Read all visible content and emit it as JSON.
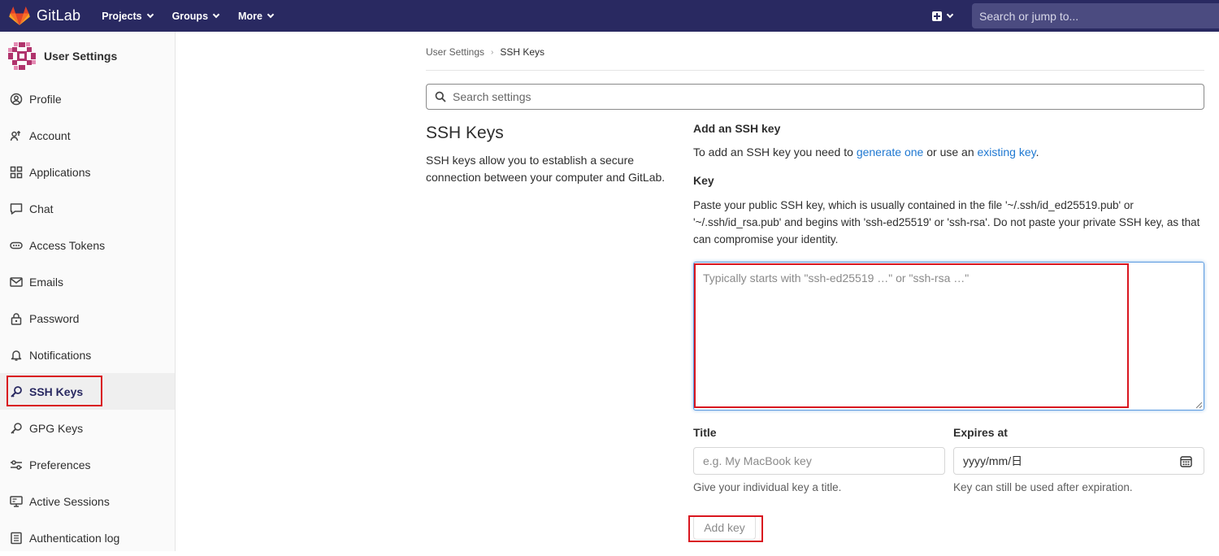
{
  "navbar": {
    "brand": "GitLab",
    "menu": [
      {
        "label": "Projects"
      },
      {
        "label": "Groups"
      },
      {
        "label": "More"
      }
    ],
    "search_placeholder": "Search or jump to..."
  },
  "sidebar": {
    "title": "User Settings",
    "items": [
      {
        "label": "Profile",
        "icon": "profile-icon"
      },
      {
        "label": "Account",
        "icon": "account-icon"
      },
      {
        "label": "Applications",
        "icon": "applications-icon"
      },
      {
        "label": "Chat",
        "icon": "chat-icon"
      },
      {
        "label": "Access Tokens",
        "icon": "token-icon"
      },
      {
        "label": "Emails",
        "icon": "mail-icon"
      },
      {
        "label": "Password",
        "icon": "lock-icon"
      },
      {
        "label": "Notifications",
        "icon": "bell-icon"
      },
      {
        "label": "SSH Keys",
        "icon": "key-icon",
        "active": true
      },
      {
        "label": "GPG Keys",
        "icon": "key-icon"
      },
      {
        "label": "Preferences",
        "icon": "preferences-icon"
      },
      {
        "label": "Active Sessions",
        "icon": "monitor-icon"
      },
      {
        "label": "Authentication log",
        "icon": "log-icon"
      }
    ]
  },
  "breadcrumb": {
    "parent": "User Settings",
    "separator": "›",
    "current": "SSH Keys"
  },
  "settings_search": {
    "placeholder": "Search settings"
  },
  "section": {
    "title": "SSH Keys",
    "description": "SSH keys allow you to establish a secure connection between your computer and GitLab."
  },
  "form": {
    "add_title": "Add an SSH key",
    "add_desc_prefix": "To add an SSH key you need to ",
    "generate_link": "generate one",
    "add_desc_middle": " or use an ",
    "existing_link": "existing key",
    "add_desc_suffix": ".",
    "key_label": "Key",
    "key_help": "Paste your public SSH key, which is usually contained in the file '~/.ssh/id_ed25519.pub' or '~/.ssh/id_rsa.pub' and begins with 'ssh-ed25519' or 'ssh-rsa'. Do not paste your private SSH key, as that can compromise your identity.",
    "key_placeholder": "Typically starts with \"ssh-ed25519 …\" or \"ssh-rsa …\"",
    "title_label": "Title",
    "title_placeholder": "e.g. My MacBook key",
    "title_hint": "Give your individual key a title.",
    "expires_label": "Expires at",
    "expires_value": "yyyy/mm/日",
    "expires_hint": "Key can still be used after expiration.",
    "submit_label": "Add key"
  },
  "colors": {
    "navbar_bg": "#292961",
    "link": "#1f78d1",
    "highlight_box": "#d9161f",
    "focus_border": "#5b9ae0"
  }
}
